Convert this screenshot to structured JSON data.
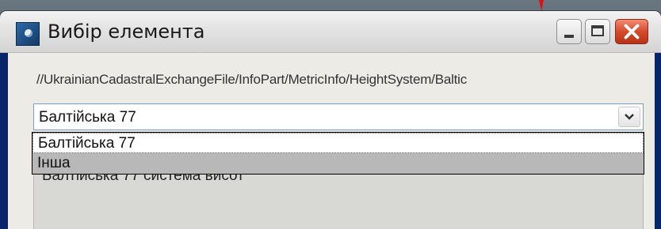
{
  "window": {
    "title": "Вибір елемента",
    "icon": "app-icon",
    "controls": [
      "minimize-icon",
      "maximize-icon",
      "close-icon"
    ]
  },
  "path": {
    "text": "//UkrainianCadastralExchangeFile/InfoPart/MetricInfo/HeightSystem/Baltic"
  },
  "combo": {
    "selected": "Балтійська 77",
    "arrow_icon": "chevron-down-icon"
  },
  "dropdown": {
    "options": [
      "Балтійська 77",
      "Інша"
    ],
    "highlighted_index": 1
  },
  "description": {
    "text": "Балтійська 77 система висот"
  },
  "colors": {
    "close_button": "#d44b2b",
    "highlight": "#b8b8b8",
    "combo_border": "#7f9db9"
  }
}
